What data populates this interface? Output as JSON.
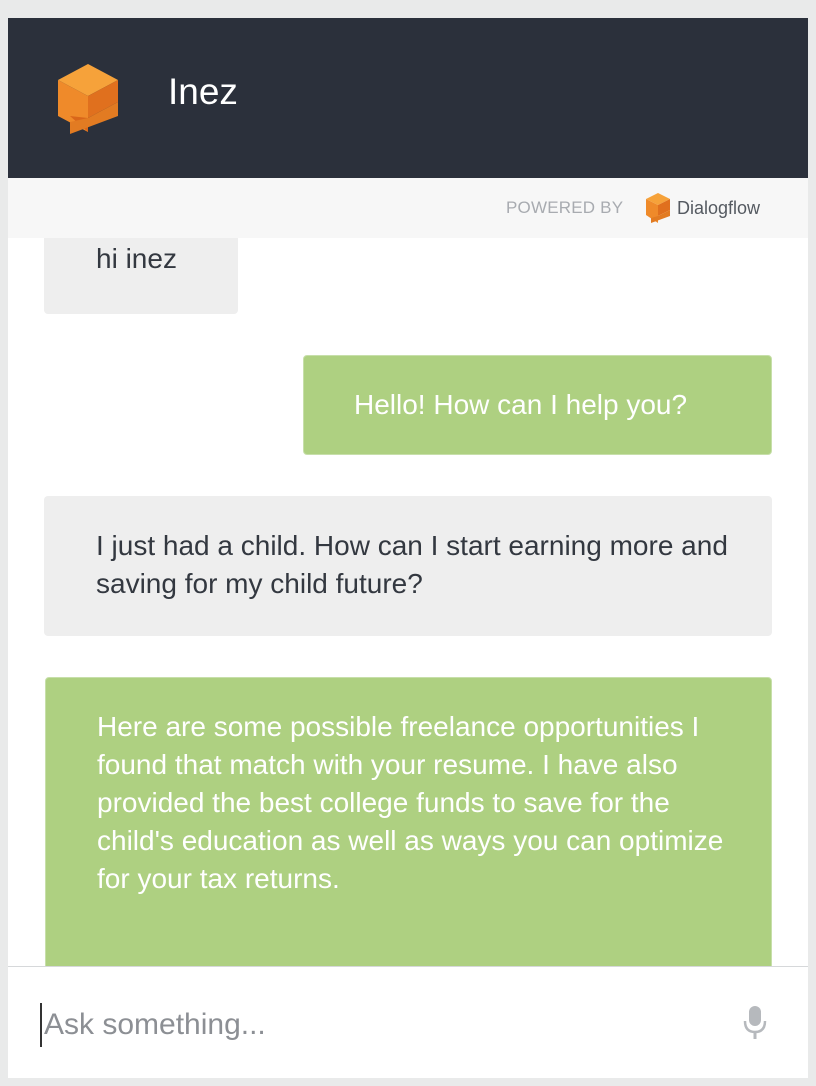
{
  "header": {
    "title": "Inez",
    "logo_icon": "dialogflow-cube-icon",
    "background": "#2b303b"
  },
  "powered_by": {
    "label": "POWERED BY",
    "brand": "Dialogflow",
    "brand_icon": "dialogflow-logo-icon"
  },
  "messages": [
    {
      "sender": "user",
      "text": "hi inez"
    },
    {
      "sender": "bot",
      "text": "Hello! How can I help you?"
    },
    {
      "sender": "user",
      "text": "I just had a child. How can I start earning more and saving for my child future?"
    },
    {
      "sender": "bot",
      "text": "Here are some possible freelance opportunities I found that match with your resume. I have also provided the best college funds to save for the child's education as well as ways you can optimize for your tax returns."
    }
  ],
  "input": {
    "placeholder": "Ask something...",
    "value": "",
    "mic_icon": "microphone-icon"
  },
  "colors": {
    "user_bubble": "#eeeeee",
    "bot_bubble": "#aed081",
    "accent_orange": "#f0932b"
  }
}
